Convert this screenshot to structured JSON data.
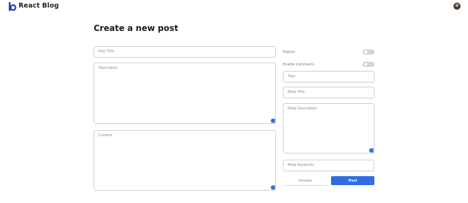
{
  "header": {
    "brand": "React Blog"
  },
  "page": {
    "title": "Create a new post"
  },
  "left": {
    "post_title_placeholder": "Post Title",
    "description_placeholder": "Description",
    "content_placeholder": "Content"
  },
  "right": {
    "publish_label": "Publish",
    "enable_comments_label": "Enable Comments",
    "publish_on": false,
    "enable_comments_on": false,
    "tags_placeholder": "Tags",
    "meta_title_placeholder": "Meta Title",
    "meta_description_placeholder": "Meta Description",
    "meta_keywords_placeholder": "Meta Keywords"
  },
  "actions": {
    "preview_label": "Preview",
    "post_label": "Post"
  },
  "colors": {
    "accent": "#2f6de0"
  }
}
